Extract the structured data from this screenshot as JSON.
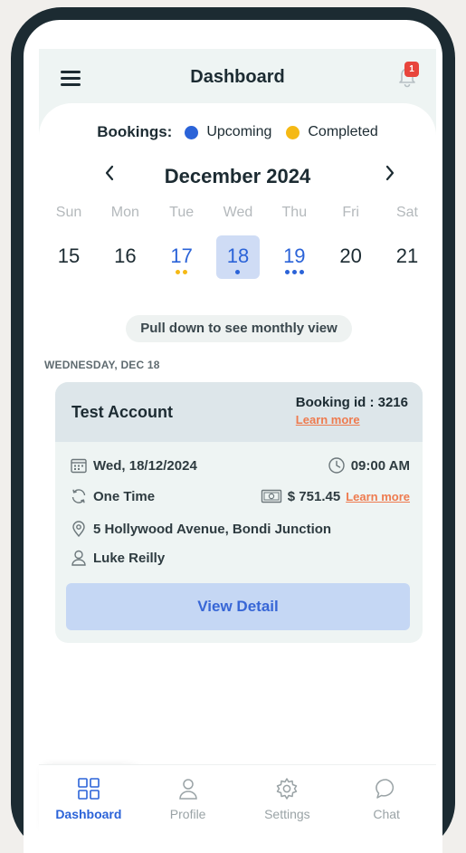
{
  "header": {
    "title": "Dashboard",
    "notification_count": "1"
  },
  "legend": {
    "title": "Bookings:",
    "items": [
      {
        "label": "Upcoming",
        "color": "#2b63d8"
      },
      {
        "label": "Completed",
        "color": "#f5b915"
      }
    ]
  },
  "calendar": {
    "month": "December 2024",
    "days": [
      {
        "dow": "Sun",
        "date": "15",
        "selected": false,
        "dots": []
      },
      {
        "dow": "Mon",
        "date": "16",
        "selected": false,
        "dots": []
      },
      {
        "dow": "Tue",
        "date": "17",
        "selected": false,
        "dots": [
          "#f5b915",
          "#f5b915"
        ]
      },
      {
        "dow": "Wed",
        "date": "18",
        "selected": true,
        "dots": [
          "#2b63d8"
        ]
      },
      {
        "dow": "Thu",
        "date": "19",
        "selected": false,
        "dots": [
          "#2b63d8",
          "#2b63d8",
          "#2b63d8"
        ]
      },
      {
        "dow": "Fri",
        "date": "20",
        "selected": false,
        "dots": []
      },
      {
        "dow": "Sat",
        "date": "21",
        "selected": false,
        "dots": []
      }
    ],
    "pull_hint": "Pull down to see monthly view"
  },
  "section": {
    "date_label": "WEDNESDAY, DEC 18"
  },
  "booking": {
    "account": "Test Account",
    "id_label": "Booking id : 3216",
    "learn_more": "Learn more",
    "date": "Wed, 18/12/2024",
    "time": "09:00 AM",
    "frequency": "One Time",
    "price": "$ 751.45",
    "price_learn_more": "Learn more",
    "address": "5 Hollywood Avenue, Bondi Junction",
    "staff": "Luke Reilly",
    "view_detail": "View Detail"
  },
  "bottom_nav": {
    "items": [
      {
        "label": "Dashboard",
        "icon": "grid-icon",
        "active": true
      },
      {
        "label": "Profile",
        "icon": "user-icon",
        "active": false
      },
      {
        "label": "Settings",
        "icon": "gear-icon",
        "active": false
      },
      {
        "label": "Chat",
        "icon": "chat-icon",
        "active": false
      }
    ]
  },
  "colors": {
    "accent": "#2b63d8",
    "completed": "#f5b915",
    "link": "#ee7b4f",
    "badge": "#e8453c"
  }
}
